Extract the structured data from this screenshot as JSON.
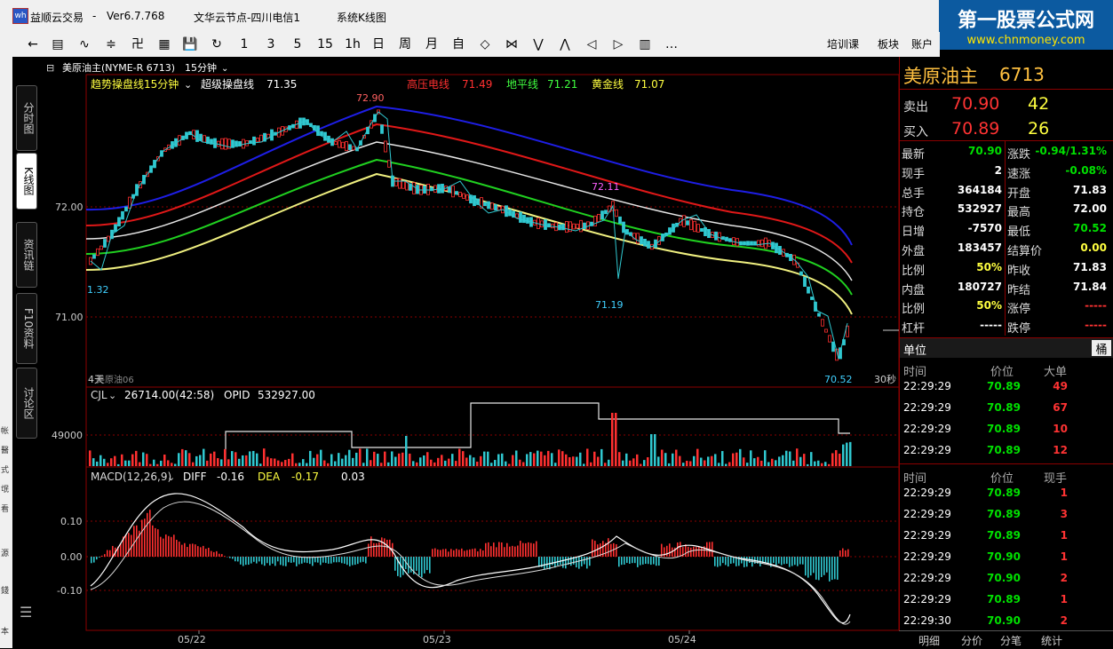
{
  "window": {
    "app_name": "益顺云交易",
    "version": "Ver6.7.768",
    "server": "文华云节点-四川电信1",
    "menu_item": "系统K线图"
  },
  "watermark": {
    "line1": "第一股票公式网",
    "line2": "www.chnmoney.com"
  },
  "toolbar": {
    "items": [
      "←",
      "▤",
      "∿",
      "≑",
      "卍",
      "▦",
      "💾",
      "↻",
      "1",
      "3",
      "5",
      "15",
      "1h",
      "日",
      "周",
      "月",
      "自",
      "◇",
      "⋈",
      "⋁",
      "⋀",
      "◁",
      "▷",
      "▥",
      "…"
    ],
    "right_items": [
      "培训课",
      "板块",
      "账户"
    ]
  },
  "left_strip": [
    "帐",
    "醫",
    "式",
    "氓",
    "看",
    "源",
    "錢",
    "本"
  ],
  "vtabs": [
    "分时图",
    "K线图",
    "资讯链",
    "F10资料",
    "讨论区"
  ],
  "chart": {
    "instrument_title": "美原油主(NYME-R 6713)",
    "period": "15分钟",
    "indicator_header": {
      "name1": "趋势操盘线15分钟",
      "name2": "超级操盘线",
      "value2": "71.35",
      "hi_label": "高压电线",
      "hi_val": "71.49",
      "lo_label": "地平线",
      "lo_val": "71.21",
      "gold_label": "黄金线",
      "gold_val": "71.07"
    },
    "price_labels": {
      "p7290": "72.90",
      "p7211": "72.11",
      "p7119": "71.19",
      "p7052": "70.52",
      "p132": "1.32"
    },
    "y_ticks": [
      "72.00",
      "71.00"
    ],
    "sub_label": "美原油06",
    "sub_prefix": "4天",
    "tf_label": "30秒",
    "volume": {
      "name": "CJL",
      "value": "26714.00(42:58)",
      "opid_label": "OPID",
      "opid": "532927.00",
      "tick": "49000"
    },
    "macd": {
      "name": "MACD(12,26,9)",
      "diff_label": "DIFF",
      "diff": "-0.16",
      "dea_label": "DEA",
      "dea": "-0.17",
      "macd": "0.03",
      "ticks": [
        "0.10",
        "0.00",
        "-0.10"
      ]
    },
    "dates": [
      "05/22",
      "05/23",
      "05/24"
    ]
  },
  "right_panel": {
    "title": "美原油主",
    "code": "6713",
    "sell": {
      "label": "卖出",
      "price": "70.90",
      "vol": "42"
    },
    "buy": {
      "label": "买入",
      "price": "70.89",
      "vol": "26"
    },
    "stats": [
      {
        "l1": "最新",
        "v1": "70.90",
        "l2": "涨跌",
        "v2": "-0.94/1.31%"
      },
      {
        "l1": "现手",
        "v1": "2",
        "l2": "速涨",
        "v2": "-0.08%"
      },
      {
        "l1": "总手",
        "v1": "364184",
        "l2": "开盘",
        "v2": "71.83"
      },
      {
        "l1": "持仓",
        "v1": "532927",
        "l2": "最高",
        "v2": "72.00"
      },
      {
        "l1": "日增",
        "v1": "-7570",
        "l2": "最低",
        "v2": "70.52"
      },
      {
        "l1": "外盘",
        "v1": "183457",
        "l2": "结算价",
        "v2": "0.00"
      },
      {
        "l1": "比例",
        "v1": "50%",
        "l2": "昨收",
        "v2": "71.83"
      },
      {
        "l1": "内盘",
        "v1": "180727",
        "l2": "昨结",
        "v2": "71.84"
      },
      {
        "l1": "比例",
        "v1": "50%",
        "l2": "涨停",
        "v2": "-----"
      },
      {
        "l1": "杠杆",
        "v1": "-----",
        "l2": "跌停",
        "v2": "-----"
      }
    ],
    "unit_label": "单位",
    "unit_value": "桶",
    "big_orders": {
      "headers": [
        "时间",
        "价位",
        "大单"
      ],
      "rows": [
        {
          "time": "22:29:29",
          "price": "70.89",
          "qty": "49"
        },
        {
          "time": "22:29:29",
          "price": "70.89",
          "qty": "67"
        },
        {
          "time": "22:29:29",
          "price": "70.89",
          "qty": "10"
        },
        {
          "time": "22:29:29",
          "price": "70.89",
          "qty": "12"
        }
      ]
    },
    "trades": {
      "headers": [
        "时间",
        "价位",
        "现手"
      ],
      "rows": [
        {
          "time": "22:29:29",
          "price": "70.89",
          "qty": "1"
        },
        {
          "time": "22:29:29",
          "price": "70.89",
          "qty": "3"
        },
        {
          "time": "22:29:29",
          "price": "70.89",
          "qty": "1"
        },
        {
          "time": "22:29:29",
          "price": "70.90",
          "qty": "1"
        },
        {
          "time": "22:29:29",
          "price": "70.90",
          "qty": "2"
        },
        {
          "time": "22:29:29",
          "price": "70.89",
          "qty": "1"
        },
        {
          "time": "22:29:30",
          "price": "70.90",
          "qty": "2"
        }
      ]
    },
    "bottom_tabs": [
      "明细",
      "分价",
      "分笔",
      "统计"
    ]
  }
}
